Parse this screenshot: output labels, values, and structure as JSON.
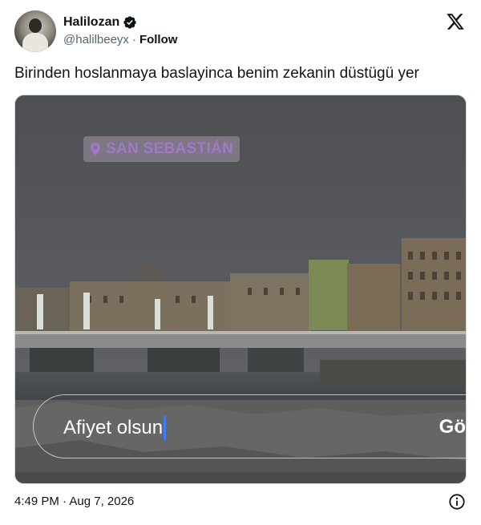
{
  "author": {
    "name": "Halilozan",
    "handle": "@halilbeeyx",
    "separator": "·",
    "follow_label": "Follow",
    "verified_color": "#0f1419",
    "icons": [
      "avatar",
      "verified-badge-icon",
      "x-logo-icon"
    ]
  },
  "tweet": {
    "text": "Birinden hoslanmaya baslayinca benim zekanin düstügü yer"
  },
  "media": {
    "location_tag": "SAN SEBASTIÁN",
    "location_color": "#a178c8",
    "message_text": "Afiyet olsun",
    "send_label_partial": "Gö",
    "caret_color": "#3d7bff"
  },
  "footer": {
    "timestamp": "4:49 PM · Aug 7, 2026",
    "icons": [
      "info-icon"
    ]
  }
}
